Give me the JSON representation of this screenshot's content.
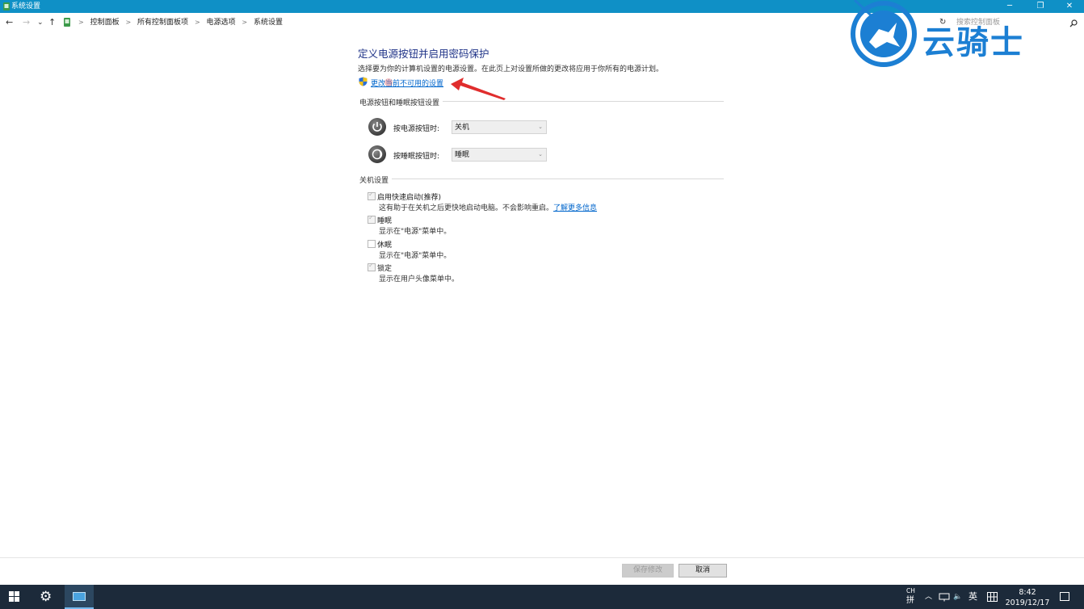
{
  "window": {
    "title": "系统设置",
    "controls": {
      "minimize": "─",
      "restore": "❐",
      "close": "✕"
    }
  },
  "address_bar": {
    "back": "←",
    "forward": "→",
    "recent": "⌄",
    "up": "↑",
    "breadcrumbs": [
      "控制面板",
      "所有控制面板项",
      "电源选项",
      "系统设置"
    ],
    "refresh": "↻",
    "search_placeholder": "搜索控制面板"
  },
  "page": {
    "heading": "定义电源按钮并启用密码保护",
    "description": "选择要为你的计算机设置的电源设置。在此页上对设置所做的更改将应用于你所有的电源计划。",
    "change_link": "更改当前不可用的设置"
  },
  "power_buttons": {
    "section_title": "电源按钮和睡眠按钮设置",
    "power_button": {
      "label": "按电源按钮时:",
      "value": "关机"
    },
    "sleep_button": {
      "label": "按睡眠按钮时:",
      "value": "睡眠"
    }
  },
  "shutdown": {
    "section_title": "关机设置",
    "items": [
      {
        "label": "启用快速启动(推荐)",
        "desc": "这有助于在关机之后更快地启动电脑。不会影响重启。",
        "link": "了解更多信息",
        "checked": true
      },
      {
        "label": "睡眠",
        "desc": "显示在\"电源\"菜单中。",
        "checked": true
      },
      {
        "label": "休眠",
        "desc": "显示在\"电源\"菜单中。",
        "checked": false
      },
      {
        "label": "锁定",
        "desc": "显示在用户头像菜单中。",
        "checked": true
      }
    ]
  },
  "footer": {
    "save": "保存修改",
    "cancel": "取消"
  },
  "taskbar": {
    "ime_top": "CH",
    "ime_bottom": "拼",
    "lang": "英",
    "time": "8:42",
    "date": "2019/12/17"
  },
  "watermark": {
    "text": "云骑士"
  },
  "colors": {
    "titlebar": "#0f90c6",
    "heading": "#1e3287",
    "link": "#0066cc",
    "taskbar": "#1c2a3a",
    "watermark": "#1c7fd3",
    "annotation_arrow": "#e02d2d"
  }
}
